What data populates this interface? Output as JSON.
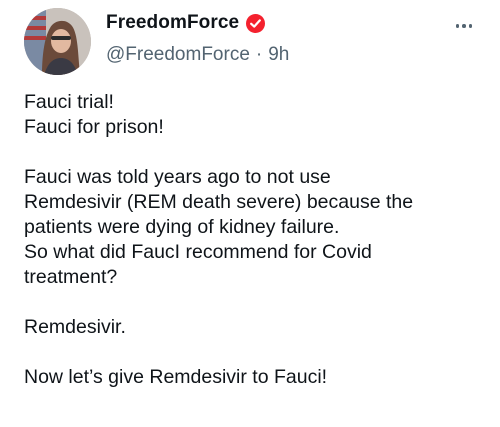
{
  "post": {
    "author": {
      "display_name": "FreedomForce",
      "handle": "@FreedomForce",
      "verified": true
    },
    "time_ago": "9h",
    "separator": "·",
    "lines": [
      "Fauci trial!",
      "Fauci for prison!",
      "",
      "Fauci was told years ago to not use",
      "Remdesivir (REM death severe) because the",
      "patients were dying of kidney failure.",
      "So what did FaucI recommend for Covid",
      "treatment?",
      "",
      "Remdesivir.",
      "",
      "Now let’s give Remdesivir to Fauci!"
    ]
  },
  "icons": {
    "verified": "verified-badge-icon",
    "more": "more-options-icon"
  },
  "colors": {
    "text": "#0f1419",
    "secondary": "#536471",
    "verified_badge": "#f4212e"
  }
}
